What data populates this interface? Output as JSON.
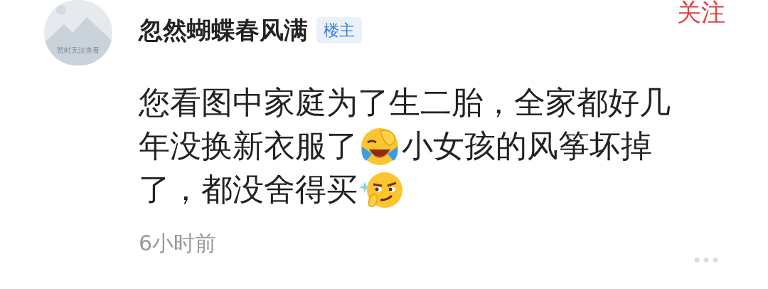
{
  "comment": {
    "avatar": {
      "placeholder_text": "暂时无法查看"
    },
    "author": "忽然蝴蝶春风满",
    "badge": "楼主",
    "follow_button": "关注",
    "lines": [
      [
        {
          "kind": "text",
          "text": "您看图中家庭为了生二胎，全家都好几"
        }
      ],
      [
        {
          "kind": "text",
          "text": "年没换新衣服了"
        },
        {
          "kind": "laughcry"
        },
        {
          "kind": "text",
          "text": "小女孩的风筝坏掉"
        }
      ],
      [
        {
          "kind": "text",
          "text": "了，都没舍得买"
        },
        {
          "kind": "smirk"
        }
      ]
    ],
    "time": "6小时前"
  }
}
